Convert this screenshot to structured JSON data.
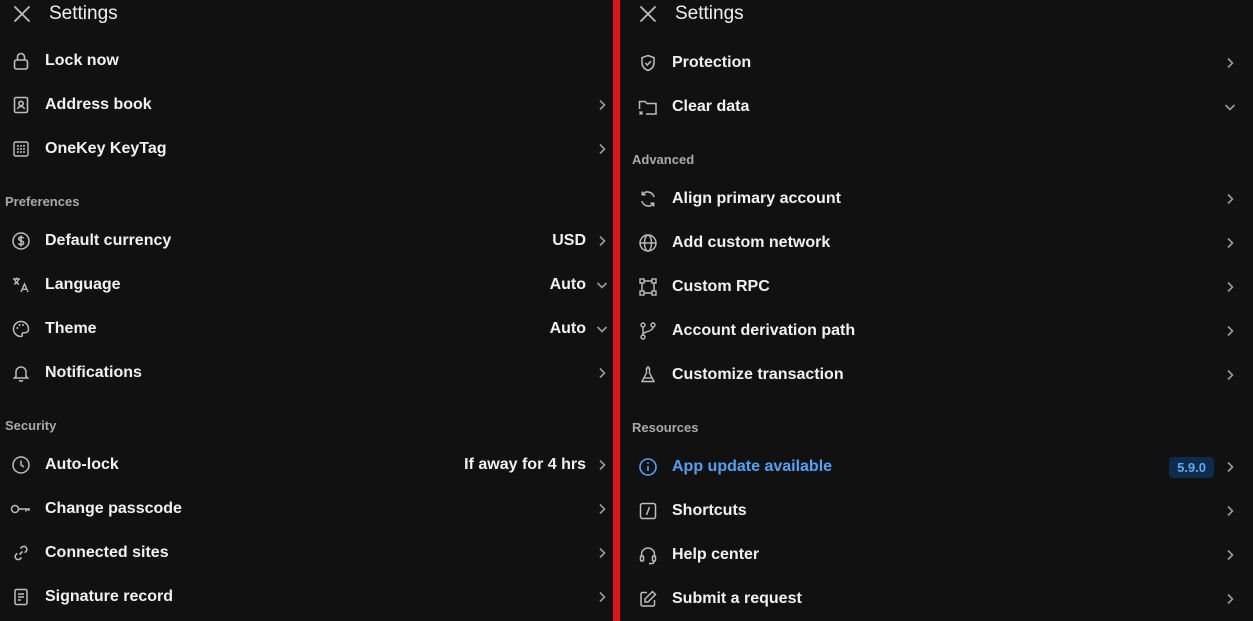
{
  "left": {
    "title": "Settings",
    "top_items": [
      {
        "label": "Lock now"
      },
      {
        "label": "Address book"
      },
      {
        "label": "OneKey KeyTag"
      }
    ],
    "preferences": {
      "heading": "Preferences",
      "items": [
        {
          "label": "Default currency",
          "value": "USD"
        },
        {
          "label": "Language",
          "value": "Auto"
        },
        {
          "label": "Theme",
          "value": "Auto"
        },
        {
          "label": "Notifications"
        }
      ]
    },
    "security": {
      "heading": "Security",
      "items": [
        {
          "label": "Auto-lock",
          "value": "If away for 4 hrs"
        },
        {
          "label": "Change passcode"
        },
        {
          "label": "Connected sites"
        },
        {
          "label": "Signature record"
        }
      ]
    }
  },
  "right": {
    "title": "Settings",
    "top_items": [
      {
        "label": "Protection"
      },
      {
        "label": "Clear data"
      }
    ],
    "advanced": {
      "heading": "Advanced",
      "items": [
        {
          "label": "Align primary account"
        },
        {
          "label": "Add custom network"
        },
        {
          "label": "Custom RPC"
        },
        {
          "label": "Account derivation path"
        },
        {
          "label": "Customize transaction"
        }
      ]
    },
    "resources": {
      "heading": "Resources",
      "items": [
        {
          "label": "App update available",
          "badge": "5.9.0"
        },
        {
          "label": "Shortcuts"
        },
        {
          "label": "Help center"
        },
        {
          "label": "Submit a request"
        }
      ]
    }
  },
  "colors": {
    "background": "#111111",
    "divider": "#e0141a",
    "accent": "#4da3f5",
    "badge_bg": "#0d2b4a"
  }
}
